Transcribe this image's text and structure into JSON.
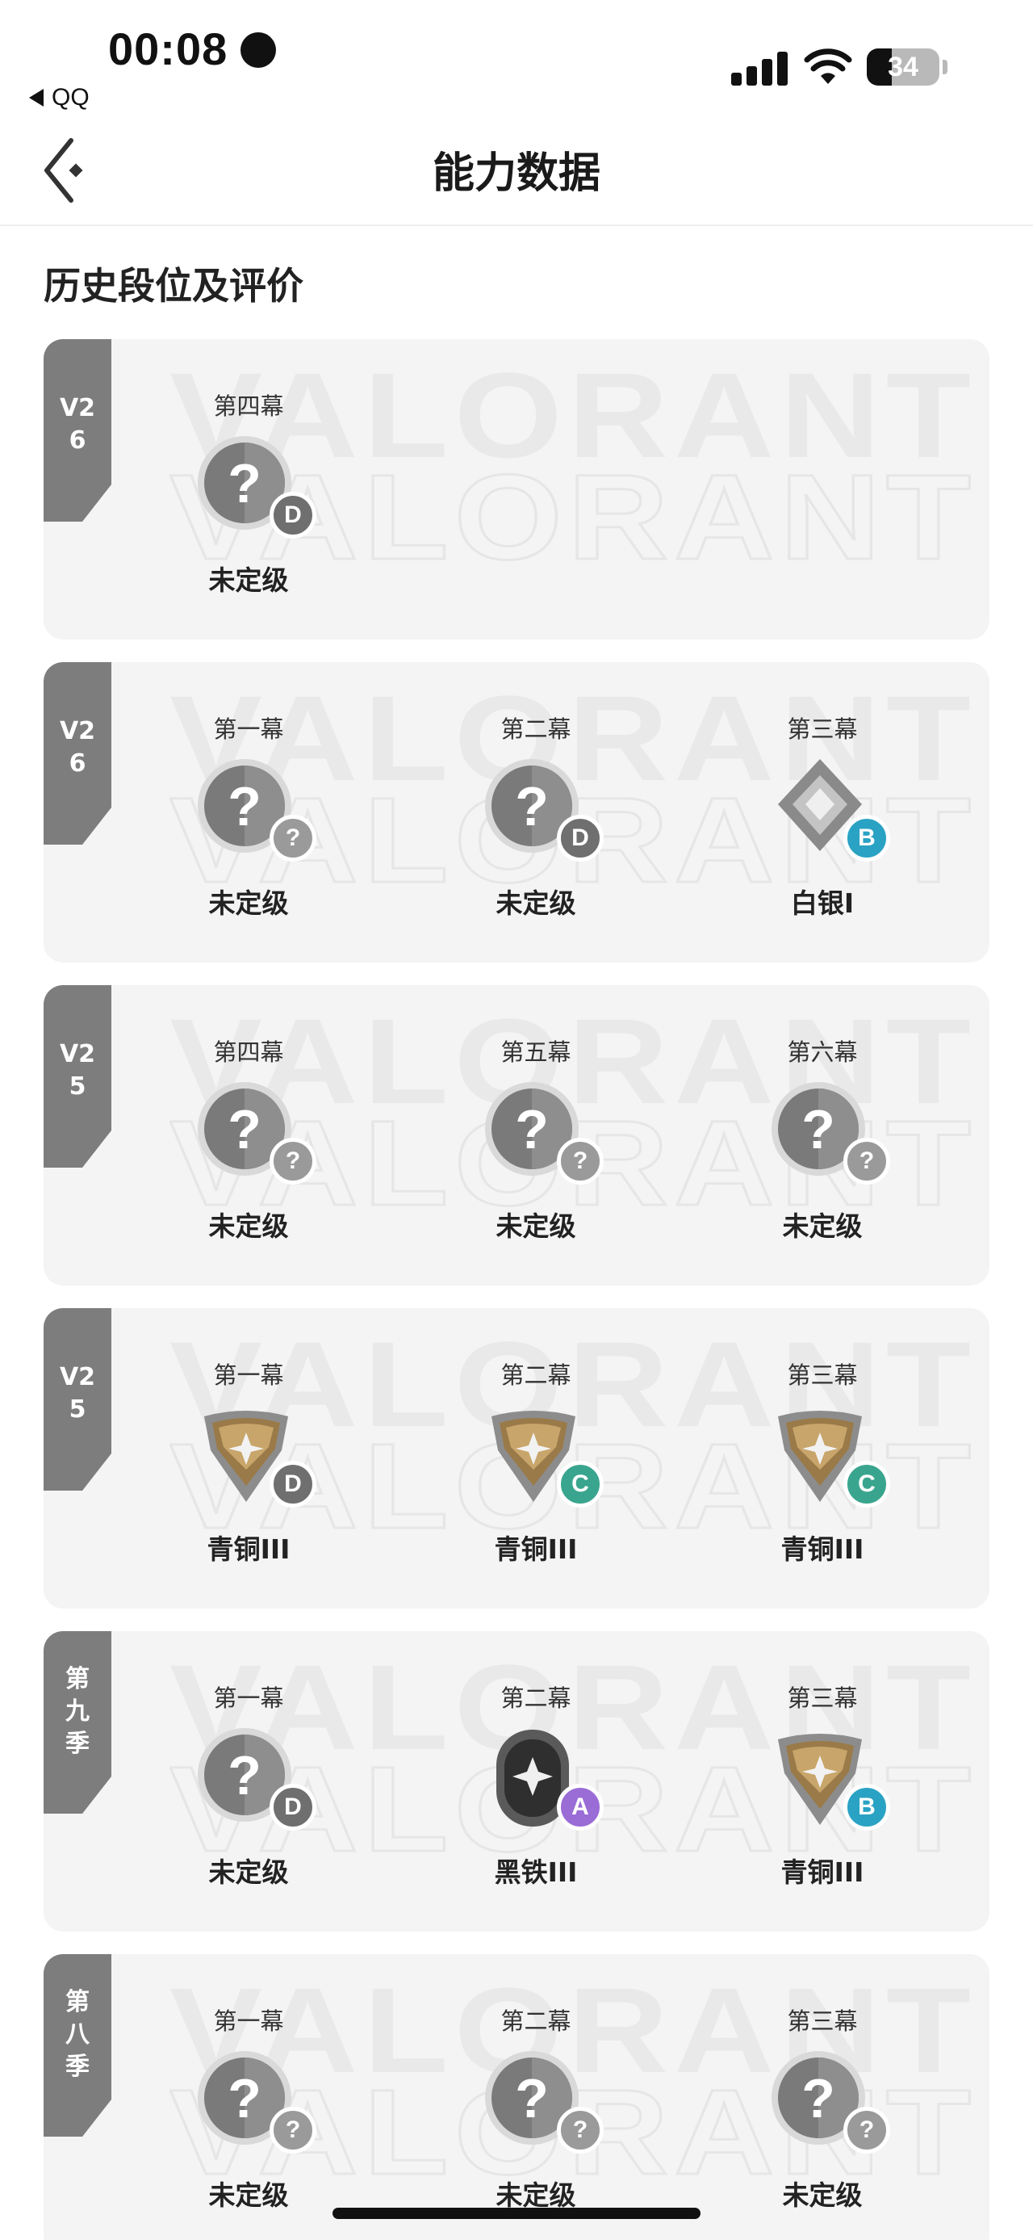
{
  "status_bar": {
    "time": "00:08",
    "back_app": "QQ",
    "battery": "34",
    "battery_level": 0.34
  },
  "header": {
    "title": "能力数据"
  },
  "section": {
    "title": "历史段位及评价"
  },
  "watermark": {
    "text": "VALORANT"
  },
  "colors": {
    "grade_unknown": "#9a9a9a",
    "grade_D": "#6f6f6f",
    "grade_C": "#3aa58e",
    "grade_B": "#2aa2c4",
    "grade_A": "#9a6cd6",
    "ribbon": "#7d7d7d"
  },
  "cards": [
    {
      "season": "V26",
      "acts": [
        {
          "act": "第四幕",
          "rank": "未定级",
          "icon": "unranked",
          "grade": "D"
        }
      ]
    },
    {
      "season": "V26",
      "acts": [
        {
          "act": "第一幕",
          "rank": "未定级",
          "icon": "unranked",
          "grade": "?"
        },
        {
          "act": "第二幕",
          "rank": "未定级",
          "icon": "unranked",
          "grade": "D"
        },
        {
          "act": "第三幕",
          "rank": "白银I",
          "icon": "silver",
          "grade": "B"
        }
      ]
    },
    {
      "season": "V25",
      "acts": [
        {
          "act": "第四幕",
          "rank": "未定级",
          "icon": "unranked",
          "grade": "?"
        },
        {
          "act": "第五幕",
          "rank": "未定级",
          "icon": "unranked",
          "grade": "?"
        },
        {
          "act": "第六幕",
          "rank": "未定级",
          "icon": "unranked",
          "grade": "?"
        }
      ]
    },
    {
      "season": "V25",
      "acts": [
        {
          "act": "第一幕",
          "rank": "青铜III",
          "icon": "bronze",
          "grade": "D"
        },
        {
          "act": "第二幕",
          "rank": "青铜III",
          "icon": "bronze",
          "grade": "C"
        },
        {
          "act": "第三幕",
          "rank": "青铜III",
          "icon": "bronze",
          "grade": "C"
        }
      ]
    },
    {
      "season": "第九季",
      "acts": [
        {
          "act": "第一幕",
          "rank": "未定级",
          "icon": "unranked",
          "grade": "D"
        },
        {
          "act": "第二幕",
          "rank": "黑铁III",
          "icon": "iron",
          "grade": "A"
        },
        {
          "act": "第三幕",
          "rank": "青铜III",
          "icon": "bronze",
          "grade": "B"
        }
      ]
    },
    {
      "season": "第八季",
      "acts": [
        {
          "act": "第一幕",
          "rank": "未定级",
          "icon": "unranked",
          "grade": "?"
        },
        {
          "act": "第二幕",
          "rank": "未定级",
          "icon": "unranked",
          "grade": "?"
        },
        {
          "act": "第三幕",
          "rank": "未定级",
          "icon": "unranked",
          "grade": "?"
        }
      ]
    }
  ]
}
